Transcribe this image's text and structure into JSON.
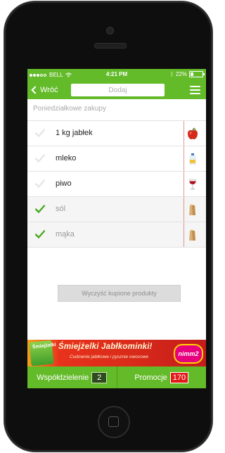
{
  "status_bar": {
    "carrier": "BELL",
    "time": "4:21 PM",
    "battery": "22%",
    "battery_level": 0.22
  },
  "nav": {
    "back_label": "Wróć",
    "add_placeholder": "Dodaj",
    "menu_icon": "hamburger-menu-icon"
  },
  "list": {
    "title": "Poniedziałkowe zakupy",
    "items": [
      {
        "label": "1 kg jabłek",
        "bought": false,
        "icon": "apple-icon"
      },
      {
        "label": "mleko",
        "bought": false,
        "icon": "milk-icon"
      },
      {
        "label": "piwo",
        "bought": false,
        "icon": "wine-glass-icon"
      },
      {
        "label": "sól",
        "bought": true,
        "icon": "bag-icon"
      },
      {
        "label": "mąka",
        "bought": true,
        "icon": "bag-icon"
      }
    ]
  },
  "clear_button": "Wyczyść kupione produkty",
  "ad": {
    "pack_text": "Śmiejżelki",
    "title": "Śmiejżelki Jabłkominki!",
    "subtitle": "Cudownie jabłkowe i pysznie owocowe",
    "logo_text": "nimm2"
  },
  "tabs": {
    "share_label": "Współdzielenie",
    "share_count": "2",
    "promo_label": "Promocje",
    "promo_count": "170"
  },
  "colors": {
    "accent": "#64bb2a",
    "check": "#4aa81f",
    "badge_red": "#e21a1a"
  }
}
